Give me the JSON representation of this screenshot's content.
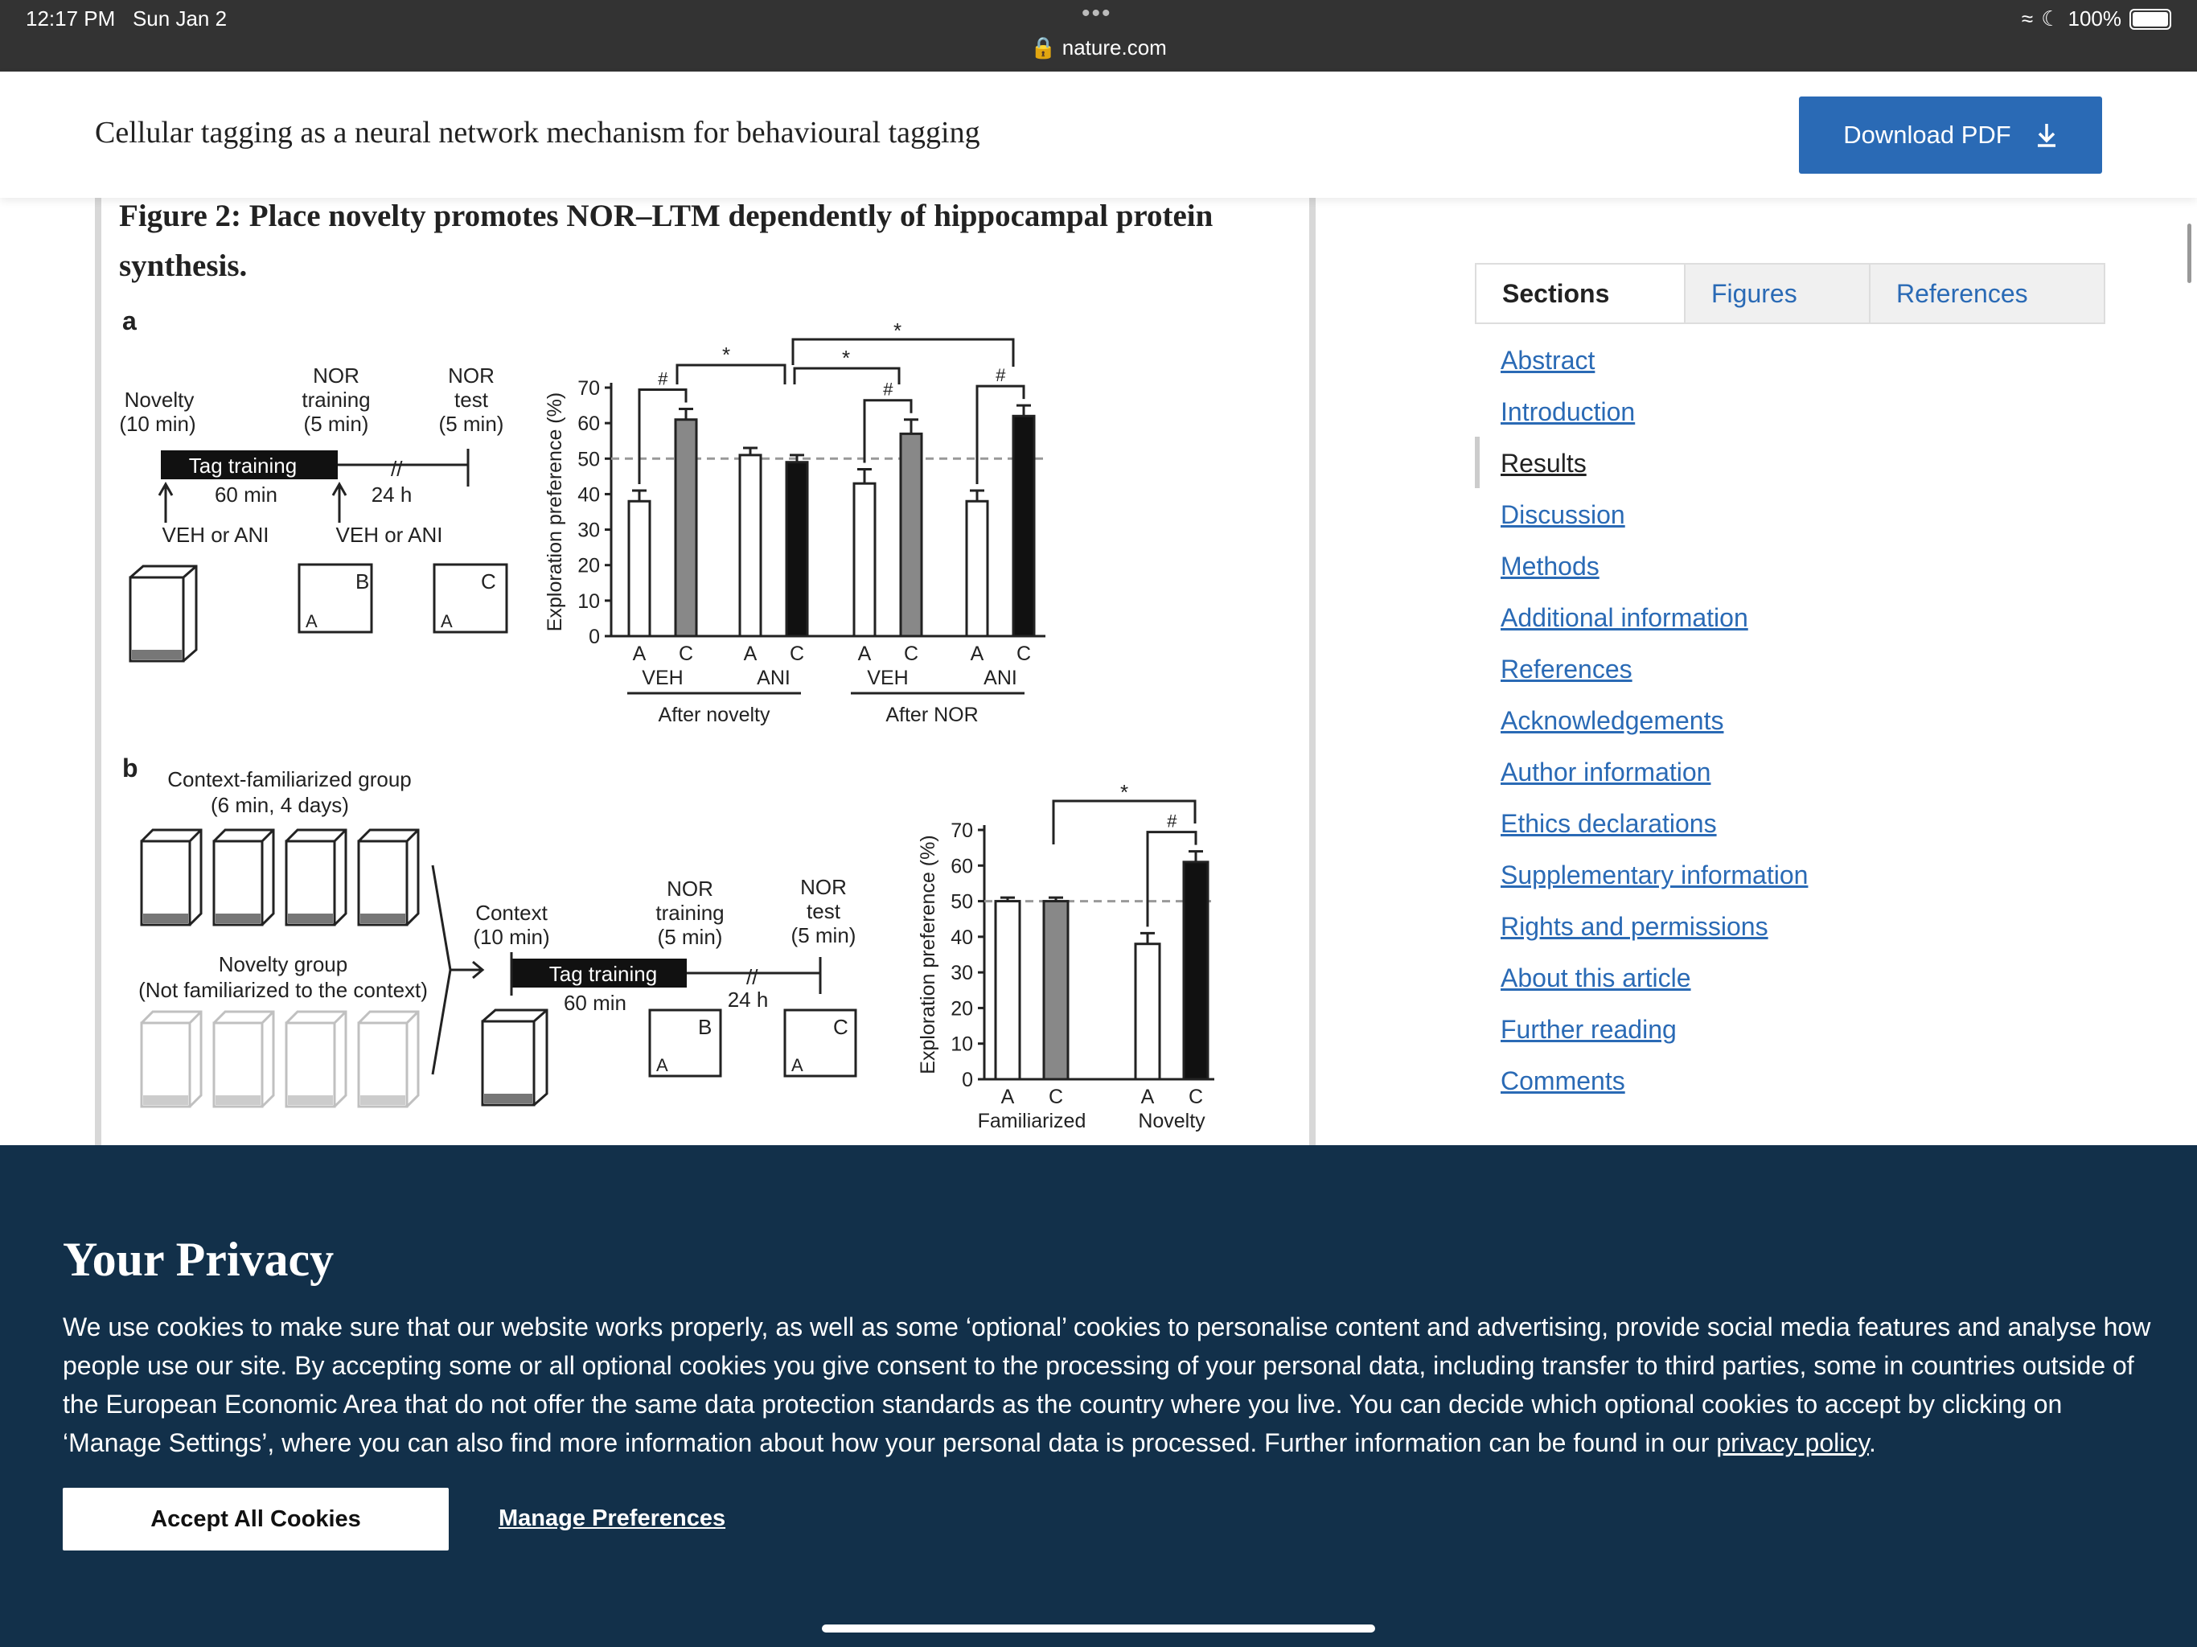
{
  "status_bar": {
    "time": "12:17 PM",
    "date": "Sun Jan 2",
    "url": "nature.com",
    "battery": "100%"
  },
  "header": {
    "title": "Cellular tagging as a neural network mechanism for behavioural tagging",
    "download_label": "Download PDF"
  },
  "figure": {
    "caption": "Figure 2: Place novelty promotes NOR–LTM dependently of hippocampal protein synthesis.",
    "panel_a": {
      "letter": "a",
      "novelty": [
        "Novelty",
        "(10 min)"
      ],
      "nor_training": [
        "NOR",
        "training",
        "(5 min)"
      ],
      "nor_test": [
        "NOR",
        "test",
        "(5 min)"
      ],
      "tag_training": "Tag training",
      "duration_60": "60 min",
      "duration_24": "24 h",
      "veh_ani_1": "VEH or ANI",
      "veh_ani_2": "VEH or ANI",
      "box_b": "B",
      "box_a": "A",
      "box_c": "C"
    },
    "panel_b": {
      "letter": "b",
      "familiarized": [
        "Context-familiarized group",
        "(6 min, 4 days)"
      ],
      "novelty_group": [
        "Novelty group",
        "(Not familiarized to the context)"
      ],
      "context": [
        "Context",
        "(10 min)"
      ],
      "nor_training": [
        "NOR",
        "training",
        "(5 min)"
      ],
      "nor_test": [
        "NOR",
        "test",
        "(5 min)"
      ],
      "tag_training": "Tag training",
      "duration_60": "60 min",
      "duration_24": "24 h",
      "box_b": "B",
      "box_a": "A",
      "box_c": "C"
    }
  },
  "chart_data": [
    {
      "type": "bar",
      "panel": "a",
      "ylabel": "Exploration preference (%)",
      "ylim": [
        0,
        70
      ],
      "yticks": [
        "0",
        "10",
        "20",
        "30",
        "40",
        "50",
        "60",
        "70"
      ],
      "reference_line": 50,
      "groups": [
        {
          "label": "VEH",
          "parent": "After novelty",
          "bars": [
            {
              "name": "A",
              "value": 38,
              "err": 3,
              "color": "#ffffff"
            },
            {
              "name": "C",
              "value": 61,
              "err": 3,
              "color": "#888888"
            }
          ],
          "marker": "#"
        },
        {
          "label": "ANI",
          "parent": "After novelty",
          "bars": [
            {
              "name": "A",
              "value": 51,
              "err": 2,
              "color": "#ffffff"
            },
            {
              "name": "C",
              "value": 49,
              "err": 2,
              "color": "#111111"
            }
          ]
        },
        {
          "label": "VEH",
          "parent": "After NOR",
          "bars": [
            {
              "name": "A",
              "value": 43,
              "err": 4,
              "color": "#ffffff"
            },
            {
              "name": "C",
              "value": 57,
              "err": 4,
              "color": "#888888"
            }
          ],
          "marker": "#"
        },
        {
          "label": "ANI",
          "parent": "After NOR",
          "bars": [
            {
              "name": "A",
              "value": 38,
              "err": 3,
              "color": "#ffffff"
            },
            {
              "name": "C",
              "value": 62,
              "err": 3,
              "color": "#111111"
            }
          ],
          "marker": "#"
        }
      ],
      "parent_labels": [
        "After novelty",
        "After NOR"
      ],
      "significance": [
        "*",
        "*",
        "*"
      ]
    },
    {
      "type": "bar",
      "panel": "b",
      "ylabel": "Exploration preference (%)",
      "ylim": [
        0,
        70
      ],
      "yticks": [
        "0",
        "10",
        "20",
        "30",
        "40",
        "50",
        "60",
        "70"
      ],
      "reference_line": 50,
      "groups": [
        {
          "label": "Familiarized",
          "bars": [
            {
              "name": "A",
              "value": 50,
              "err": 1,
              "color": "#ffffff"
            },
            {
              "name": "C",
              "value": 50,
              "err": 1,
              "color": "#888888"
            }
          ]
        },
        {
          "label": "Novelty",
          "bars": [
            {
              "name": "A",
              "value": 38,
              "err": 3,
              "color": "#ffffff"
            },
            {
              "name": "C",
              "value": 61,
              "err": 3,
              "color": "#111111"
            }
          ],
          "marker": "#"
        }
      ],
      "significance": [
        "*"
      ]
    }
  ],
  "sidebar": {
    "tabs": [
      {
        "label": "Sections"
      },
      {
        "label": "Figures"
      },
      {
        "label": "References"
      }
    ],
    "sections": [
      {
        "label": "Abstract"
      },
      {
        "label": "Introduction"
      },
      {
        "label": "Results"
      },
      {
        "label": "Discussion"
      },
      {
        "label": "Methods"
      },
      {
        "label": "Additional information"
      },
      {
        "label": "References"
      },
      {
        "label": "Acknowledgements"
      },
      {
        "label": "Author information"
      },
      {
        "label": "Ethics declarations"
      },
      {
        "label": "Supplementary information"
      },
      {
        "label": "Rights and permissions"
      },
      {
        "label": "About this article"
      },
      {
        "label": "Further reading"
      },
      {
        "label": "Comments"
      }
    ],
    "current_section": "Results"
  },
  "privacy": {
    "title": "Your Privacy",
    "text": "We use cookies to make sure that our website works properly, as well as some ‘optional’ cookies to personalise content and advertising, provide social media features and analyse how people use our site. By accepting some or all optional cookies you give consent to the processing of your personal data, including transfer to third parties, some in countries outside of the European Economic Area that do not offer the same data protection standards as the country where you live. You can decide which optional cookies to accept by clicking on ‘Manage Settings’, where you can also find more information about how your personal data is processed. Further information can be found in our ",
    "link": "privacy policy",
    "accept_label": "Accept All Cookies",
    "manage_label": "Manage Preferences"
  }
}
